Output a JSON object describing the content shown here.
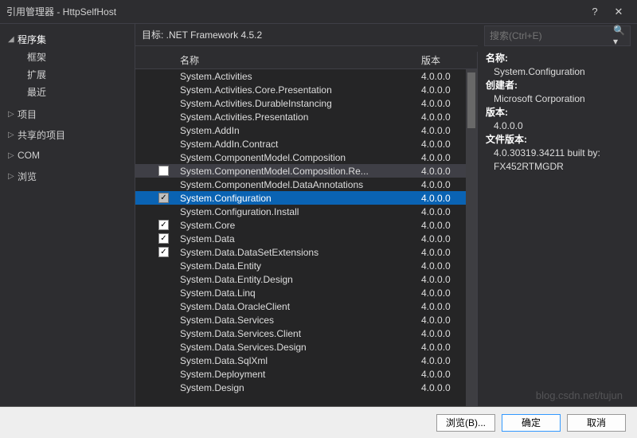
{
  "window": {
    "title": "引用管理器 - HttpSelfHost"
  },
  "sidebar": {
    "assemblies": {
      "label": "程序集",
      "children": [
        "框架",
        "扩展",
        "最近"
      ]
    },
    "items": [
      {
        "label": "项目"
      },
      {
        "label": "共享的项目"
      },
      {
        "label": "COM"
      },
      {
        "label": "浏览"
      }
    ]
  },
  "target": {
    "label": "目标: .NET Framework 4.5.2"
  },
  "columns": {
    "name": "名称",
    "version": "版本"
  },
  "rows": [
    {
      "name": "System.Activities",
      "ver": "4.0.0.0",
      "chk": ""
    },
    {
      "name": "System.Activities.Core.Presentation",
      "ver": "4.0.0.0",
      "chk": ""
    },
    {
      "name": "System.Activities.DurableInstancing",
      "ver": "4.0.0.0",
      "chk": ""
    },
    {
      "name": "System.Activities.Presentation",
      "ver": "4.0.0.0",
      "chk": ""
    },
    {
      "name": "System.AddIn",
      "ver": "4.0.0.0",
      "chk": ""
    },
    {
      "name": "System.AddIn.Contract",
      "ver": "4.0.0.0",
      "chk": ""
    },
    {
      "name": "System.ComponentModel.Composition",
      "ver": "4.0.0.0",
      "chk": ""
    },
    {
      "name": "System.ComponentModel.Composition.Re...",
      "ver": "4.0.0.0",
      "chk": "empty",
      "hover": true
    },
    {
      "name": "System.ComponentModel.DataAnnotations",
      "ver": "4.0.0.0",
      "chk": ""
    },
    {
      "name": "System.Configuration",
      "ver": "4.0.0.0",
      "chk": "checked-gray",
      "selected": true
    },
    {
      "name": "System.Configuration.Install",
      "ver": "4.0.0.0",
      "chk": ""
    },
    {
      "name": "System.Core",
      "ver": "4.0.0.0",
      "chk": "checked"
    },
    {
      "name": "System.Data",
      "ver": "4.0.0.0",
      "chk": "checked"
    },
    {
      "name": "System.Data.DataSetExtensions",
      "ver": "4.0.0.0",
      "chk": "checked"
    },
    {
      "name": "System.Data.Entity",
      "ver": "4.0.0.0",
      "chk": ""
    },
    {
      "name": "System.Data.Entity.Design",
      "ver": "4.0.0.0",
      "chk": ""
    },
    {
      "name": "System.Data.Linq",
      "ver": "4.0.0.0",
      "chk": ""
    },
    {
      "name": "System.Data.OracleClient",
      "ver": "4.0.0.0",
      "chk": ""
    },
    {
      "name": "System.Data.Services",
      "ver": "4.0.0.0",
      "chk": ""
    },
    {
      "name": "System.Data.Services.Client",
      "ver": "4.0.0.0",
      "chk": ""
    },
    {
      "name": "System.Data.Services.Design",
      "ver": "4.0.0.0",
      "chk": ""
    },
    {
      "name": "System.Data.SqlXml",
      "ver": "4.0.0.0",
      "chk": ""
    },
    {
      "name": "System.Deployment",
      "ver": "4.0.0.0",
      "chk": ""
    },
    {
      "name": "System.Design",
      "ver": "4.0.0.0",
      "chk": ""
    }
  ],
  "search": {
    "placeholder": "搜索(Ctrl+E)"
  },
  "details": {
    "name_label": "名称:",
    "name_value": "System.Configuration",
    "creator_label": "创建者:",
    "creator_value": "Microsoft Corporation",
    "version_label": "版本:",
    "version_value": "4.0.0.0",
    "filever_label": "文件版本:",
    "filever_value1": "4.0.30319.34211 built by:",
    "filever_value2": "FX452RTMGDR"
  },
  "footer": {
    "browse": "浏览(B)...",
    "ok": "确定",
    "cancel": "取消"
  },
  "watermark": "blog.csdn.net/tujun"
}
